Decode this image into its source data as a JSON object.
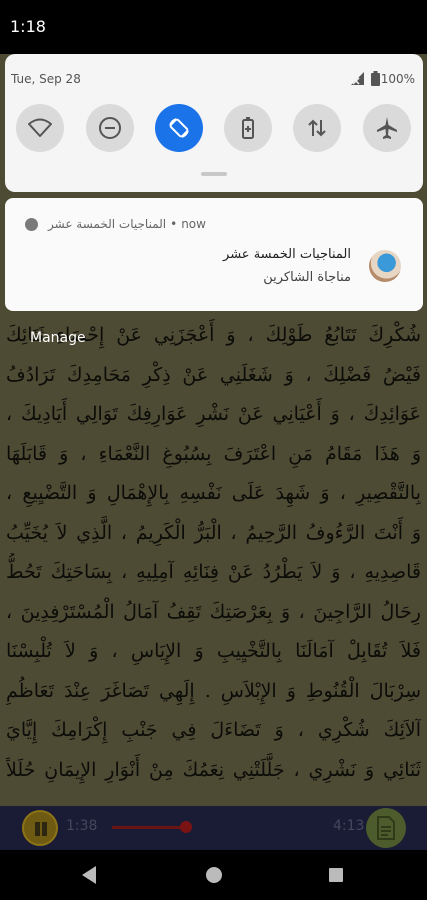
{
  "status_bar": {
    "time": "1:18"
  },
  "quick_settings": {
    "date": "Tue, Sep 28",
    "battery": "100%",
    "tiles": [
      {
        "name": "wifi",
        "icon": "wifi-icon",
        "active": false
      },
      {
        "name": "do-not-disturb",
        "icon": "do-not-disturb-icon",
        "active": false
      },
      {
        "name": "auto-rotate",
        "icon": "auto-rotate-icon",
        "active": true
      },
      {
        "name": "battery-saver",
        "icon": "battery-saver-icon",
        "active": false
      },
      {
        "name": "mobile-data",
        "icon": "mobile-data-icon",
        "active": false
      },
      {
        "name": "airplane-mode",
        "icon": "airplane-icon",
        "active": false
      }
    ],
    "accent": "#1a73e8"
  },
  "notification": {
    "app_name": "المناجيات الخمسة عشر",
    "separator": "•",
    "when": "now",
    "title": "المناجيات الخمسة عشر",
    "text": "مناجاة الشاكرين"
  },
  "manage_label": "Manage",
  "reader": {
    "lines": [
      "شُكْرِكَ تَتَابُعُ طَوْلِكَ ، وَ أَعْجَزَنِي عَنْ إِحْصَاءِ ثَنَائِكَ",
      "فَيْضُ فَضْلِكَ ، وَ شَغَلَنِي عَنْ ذِكْرِ مَحَامِدِكَ تَرَادُفُ",
      "عَوَائِدِكَ ، وَ أَعْيَانِي عَنْ نَشْرِ عَوَارِفِكَ تَوَالِي أَيَادِيكَ ،",
      "وَ هَذَا مَقَامُ مَنِ اعْتَرَفَ بِسُبُوغِ النَّعْمَاءِ ، وَ قَابَلَهَا",
      "بِالتَّقْصِيرِ ، وَ شَهِدَ عَلَى نَفْسِهِ بِالإِهْمَالِ وَ التَّضْيِيعِ ،",
      "وَ أَنْتَ الرَّءُوفُ الرَّحِيمُ ، الْبَرُّ الْكَرِيمُ ، الَّذِي لاَ يُخَيِّبُ",
      "قَاصِدِيهِ ، وَ لاَ يَطْرُدُ عَنْ فِنَائِهِ آمِلِيهِ ، بِسَاحَتِكَ تَحُطُّ",
      "رِحَالُ الرَّاجِينَ ، وَ بِعَرْصَتِكَ تَقِفُ آمَالُ الْمُسْتَرْفِدِينَ ،",
      "فَلاَ تُقَابِلْ آمَالَنَا بِالتَّخْيِيبِ وَ الإِيَاسِ ، وَ لاَ تُلْبِسْنَا",
      "سِرْبَالَ الْقُنُوطِ وَ الإِبْلاَسِ . إِلَهِي تَصَاغَرَ عِنْدَ تَعَاظُمِ",
      "آلاَئِكَ شُكْرِي ، وَ تَضَاءَلَ فِي جَنْبِ إِكْرَامِكَ إِيَّايَ",
      "ثَنَائِي وَ نَشْرِي ، جَلَّلَتْنِي نِعَمُكَ مِنْ أَنْوَارِ الإِيمَانِ حُلَلاً"
    ]
  },
  "player": {
    "elapsed": "1:38",
    "total": "4:13",
    "progress_fraction": 0.39
  }
}
